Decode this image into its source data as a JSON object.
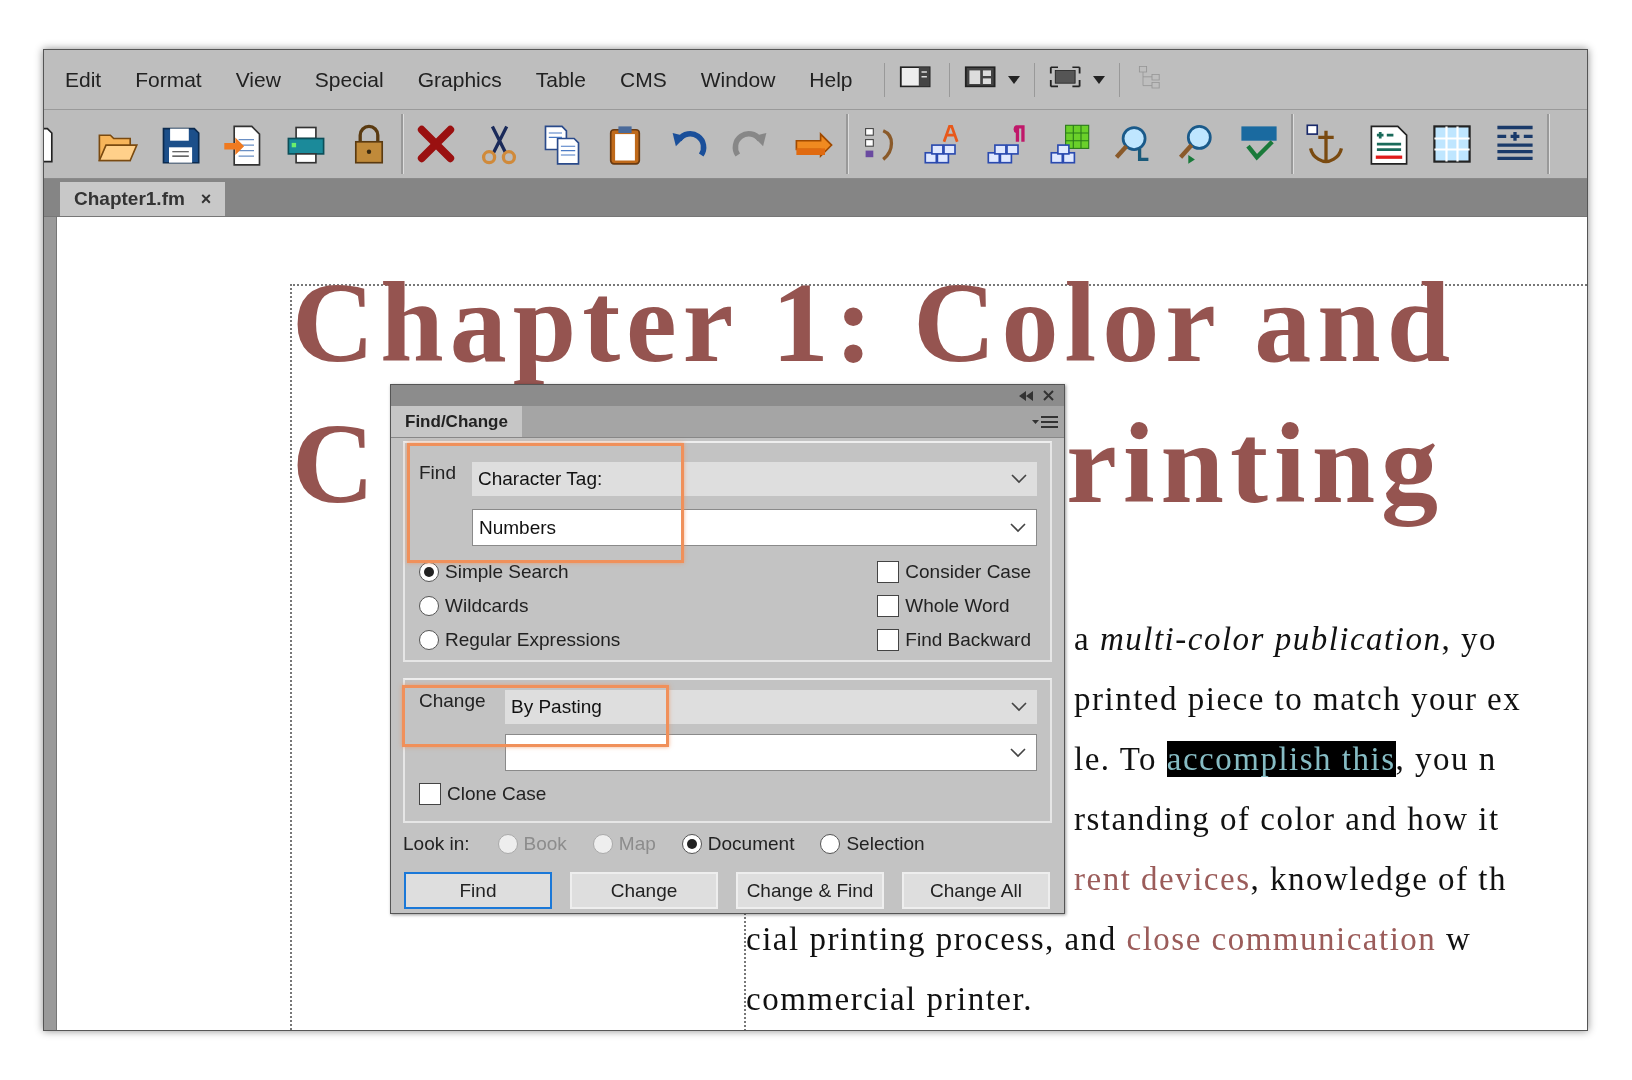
{
  "menu_bar": {
    "items": [
      "Edit",
      "Format",
      "View",
      "Special",
      "Graphics",
      "Table",
      "CMS",
      "Window",
      "Help"
    ],
    "view_buttons": [
      {
        "kind": "panel",
        "dropdown": false,
        "disabled": false
      },
      {
        "kind": "layout",
        "dropdown": true,
        "disabled": false
      },
      {
        "kind": "fullscreen",
        "dropdown": true,
        "disabled": false
      },
      {
        "kind": "tree",
        "dropdown": false,
        "disabled": true
      }
    ]
  },
  "toolbar": {
    "groups": [
      [
        {
          "kind": "page",
          "disabled": false
        },
        {
          "kind": "folder",
          "disabled": false
        },
        {
          "kind": "save",
          "disabled": false
        },
        {
          "kind": "import",
          "disabled": false
        },
        {
          "kind": "printer",
          "disabled": false
        },
        {
          "kind": "lock",
          "disabled": false
        }
      ],
      [
        {
          "kind": "delete",
          "disabled": false
        },
        {
          "kind": "cut",
          "disabled": false
        },
        {
          "kind": "copy",
          "disabled": false
        },
        {
          "kind": "paste",
          "disabled": false
        },
        {
          "kind": "undo",
          "disabled": false
        },
        {
          "kind": "redo",
          "disabled": true
        },
        {
          "kind": "forward",
          "disabled": false
        }
      ],
      [
        {
          "kind": "list",
          "disabled": false
        },
        {
          "kind": "chartag",
          "disabled": false
        },
        {
          "kind": "paratag",
          "disabled": false
        },
        {
          "kind": "tabletag",
          "disabled": false
        },
        {
          "kind": "findzoom",
          "disabled": false
        },
        {
          "kind": "zoom",
          "disabled": false
        },
        {
          "kind": "spell",
          "disabled": false
        }
      ],
      [
        {
          "kind": "anchor",
          "disabled": false
        },
        {
          "kind": "form",
          "disabled": false
        },
        {
          "kind": "table",
          "disabled": false
        },
        {
          "kind": "lines",
          "disabled": false
        }
      ]
    ]
  },
  "tabs": [
    {
      "label": "Chapter1.fm",
      "close": "×",
      "selected": true
    }
  ],
  "document": {
    "heading_lines": [
      {
        "parts": [
          "Chapter 1: Color and"
        ]
      },
      {
        "parts": [
          "C",
          "rinting"
        ]
      }
    ],
    "body_lines": [
      {
        "covered_start": true,
        "runs": [
          {
            "kind": "plain",
            "text": "a "
          },
          {
            "kind": "italic",
            "text": "multi-color publication"
          },
          {
            "kind": "plain",
            "text": ", yo"
          }
        ]
      },
      {
        "covered_start": true,
        "runs": [
          {
            "kind": "plain",
            "text": "printed piece to match your ex"
          }
        ]
      },
      {
        "covered_start": true,
        "runs": [
          {
            "kind": "plain",
            "text": "le. To "
          },
          {
            "kind": "selected",
            "text": "accomplish this"
          },
          {
            "kind": "plain",
            "text": ", you n"
          }
        ]
      },
      {
        "covered_start": true,
        "runs": [
          {
            "kind": "plain",
            "text": "rstanding of color and how it"
          }
        ]
      },
      {
        "covered_start": true,
        "runs": [
          {
            "kind": "link",
            "text": "rent devices"
          },
          {
            "kind": "plain",
            "text": ", knowledge of th"
          }
        ]
      },
      {
        "covered_start": false,
        "runs": [
          {
            "kind": "plain",
            "text": "cial printing process, and "
          },
          {
            "kind": "link",
            "text": "close communication"
          },
          {
            "kind": "plain",
            "text": " w"
          }
        ]
      },
      {
        "covered_start": false,
        "runs": [
          {
            "kind": "plain",
            "text": "commercial printer."
          }
        ]
      }
    ]
  },
  "find_change": {
    "tab": "Find/Change",
    "find": {
      "label": "Find",
      "type": "Character Tag:",
      "value": "Numbers",
      "highlighted": true
    },
    "search_modes": [
      {
        "label": "Simple Search",
        "selected": true
      },
      {
        "label": "Wildcards",
        "selected": false
      },
      {
        "label": "Regular Expressions",
        "selected": false
      }
    ],
    "options": [
      {
        "label": "Consider Case",
        "checked": false
      },
      {
        "label": "Whole Word",
        "checked": false
      },
      {
        "label": "Find Backward",
        "checked": false
      }
    ],
    "change": {
      "label": "Change",
      "type": "By Pasting",
      "highlighted": true
    },
    "clone_case": {
      "label": "Clone Case",
      "checked": false
    },
    "look_in": {
      "label": "Look in:",
      "options": [
        {
          "label": "Book",
          "selected": false,
          "disabled": true
        },
        {
          "label": "Map",
          "selected": false,
          "disabled": true
        },
        {
          "label": "Document",
          "selected": true,
          "disabled": false
        },
        {
          "label": "Selection",
          "selected": false,
          "disabled": false
        }
      ]
    },
    "buttons": [
      {
        "label": "Find",
        "focused": true
      },
      {
        "label": "Change",
        "focused": false
      },
      {
        "label": "Change & Find",
        "focused": false
      },
      {
        "label": "Change All",
        "focused": false
      }
    ]
  }
}
